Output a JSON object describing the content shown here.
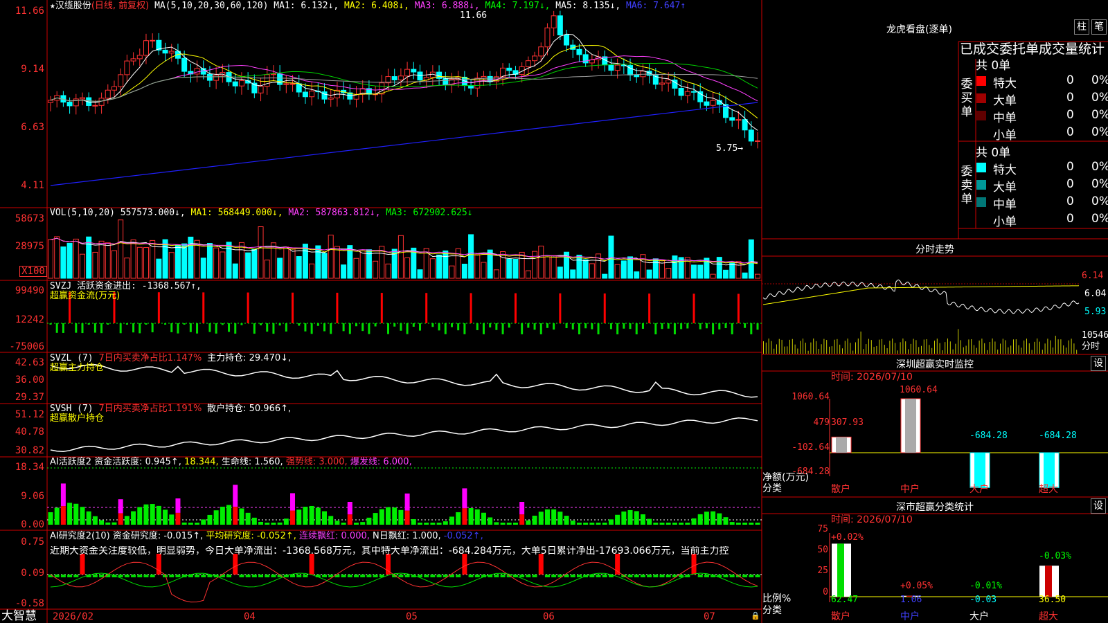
{
  "app_name": "大智慧",
  "stock": {
    "star": "★",
    "name": "汉缆股份",
    "mode": "(日线, 前复权)"
  },
  "kline": {
    "ma_header": {
      "label": "MA(5,10,20,30,60,120)",
      "ma1": "MA1: 6.132↓,",
      "ma2": "MA2: 6.408↓,",
      "ma3": "MA3: 6.888↓,",
      "ma4": "MA4: 7.197↓,",
      "ma5": "MA5: 8.135↓,",
      "ma6": "MA6: 7.647↑"
    },
    "y_labels": [
      "11.66",
      "9.14",
      "6.63",
      "4.11"
    ],
    "high_label": "11.66",
    "low_label": "5.75→",
    "colors": {
      "up": "#ff3232",
      "down": "#00ffff",
      "ma1": "#ffffff",
      "ma2": "#ffff00",
      "ma3": "#ff40ff",
      "ma4": "#00d000",
      "ma5": "#a0a0a0",
      "ma6": "#2020ff"
    }
  },
  "volume": {
    "header": {
      "label": "VOL(5,10,20)",
      "val": "557573.000↓,",
      "ma1": "MA1: 568449.000↓,",
      "ma2": "MA2: 587863.812↓,",
      "ma3": "MA3: 672902.625↓"
    },
    "y_labels": [
      "58673",
      "28975"
    ],
    "unit": "X100"
  },
  "svzj": {
    "header": "SVZJ  活跃资金进出: -1368.567↑,",
    "sub": "超赢资金流(万元)",
    "y_labels": [
      "99490",
      "12242",
      "-75006"
    ]
  },
  "svzl": {
    "header_a": "SVZL (7)",
    "header_b": "7日内买卖净占比1.147%",
    "header_c": "主力持仓: 29.470↓,",
    "sub": "超赢主力持仓",
    "y_labels": [
      "42.63",
      "36.00",
      "29.37"
    ]
  },
  "svsh": {
    "header_a": "SVSH (7)",
    "header_b": "7日内买卖净占比1.191%",
    "header_c": "散户持仓: 50.966↑,",
    "sub": "超赢散户持仓",
    "y_labels": [
      "51.12",
      "40.78",
      "30.82"
    ]
  },
  "ai_active": {
    "a": "AI活跃度2",
    "b": "资金活跃度: 0.945↑,",
    "c": "18.344,",
    "d": "生命线: 1.560,",
    "e": "强势线: 3.000,",
    "f": "爆发线: 6.000,",
    "y_labels": [
      "18.34",
      "9.06",
      "0.00"
    ]
  },
  "ai_research": {
    "a": "AI研究度2(10)",
    "b": "资金研究度: -0.015↑,",
    "c": "平均研究度: -0.052↑,",
    "d": "连续飘红: 0.000,",
    "e": "N日飘红: 1.000,",
    "f": "-0.052↑,",
    "comment": "近期大资金关注度较低，明显弱势，今日大单净流出：-1368.568万元，其中特大单净流出：-684.284万元，大单5日累计净出-17693.066万元，当前主力控",
    "y_labels": [
      "0.75",
      "0.09",
      "-0.58"
    ]
  },
  "x_axis": [
    "2026/02",
    "04",
    "05",
    "06",
    "07"
  ],
  "right": {
    "dragon": {
      "title": "龙虎看盘(逐单)",
      "btn_col": "柱",
      "btn_tick": "笔",
      "subtitle": "已成交委托单成交量统计",
      "buy_label": "委买单",
      "sell_label": "委卖单",
      "buy_total": "共 0单",
      "sell_total": "共 0单",
      "buy_rows": [
        {
          "name": "特大",
          "val": "0",
          "pct": "0%",
          "color": "#ff0000"
        },
        {
          "name": "大单",
          "val": "0",
          "pct": "0%",
          "color": "#a00000"
        },
        {
          "name": "中单",
          "val": "0",
          "pct": "0%",
          "color": "#600000"
        },
        {
          "name": "小单",
          "val": "0",
          "pct": "0%",
          "color": ""
        }
      ],
      "sell_rows": [
        {
          "name": "特大",
          "val": "0",
          "pct": "0%",
          "color": "#00ffff"
        },
        {
          "name": "大单",
          "val": "0",
          "pct": "0%",
          "color": "#009999"
        },
        {
          "name": "中单",
          "val": "0",
          "pct": "0%",
          "color": "#007777"
        },
        {
          "name": "小单",
          "val": "0",
          "pct": "0%",
          "color": ""
        }
      ]
    },
    "intraday": {
      "title": "分时走势",
      "y_labels": [
        "6.14",
        "6.04",
        "5.93"
      ],
      "vol_label": "10546",
      "vol_unit": "分时"
    },
    "sz_monitor": {
      "title": "深圳超赢实时监控",
      "btn": "设",
      "time": "时间: 2026/07/10",
      "y_labels": [
        "1060.64",
        "479",
        "-102.64",
        "-684.28"
      ],
      "unit_a": "净额(万元)",
      "unit_b": "分类",
      "categories": [
        "散户",
        "中户",
        "大户",
        "超大"
      ],
      "values": [
        307.93,
        1060.64,
        -684.28,
        -684.28
      ],
      "value_labels": [
        "307.93",
        "1060.64",
        "-684.28",
        "-684.28"
      ]
    },
    "sz_class": {
      "title": "深市超赢分类统计",
      "btn": "设",
      "time": "时间: 2026/07/10",
      "y_labels": [
        "75",
        "50",
        "25",
        "0"
      ],
      "unit_a": "比例%",
      "unit_b": "分类",
      "categories": [
        "散户",
        "中户",
        "大户",
        "超大"
      ],
      "values": [
        62.47,
        1.06,
        -0.03,
        36.5
      ],
      "change_labels": [
        "+0.02%",
        "+0.05%",
        "-0.01%",
        "-0.03%"
      ],
      "value_labels": [
        "62.47",
        "1.06",
        "-0.03",
        "36.50"
      ]
    }
  }
}
